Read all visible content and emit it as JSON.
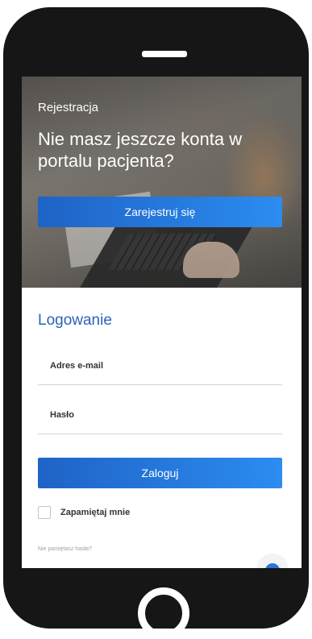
{
  "registration": {
    "label": "Rejestracja",
    "question": "Nie masz jeszcze konta w portalu pacjenta?",
    "button": "Zarejestruj się"
  },
  "login": {
    "title": "Logowanie",
    "email_label": "Adres e-mail",
    "password_label": "Hasło",
    "button": "Zaloguj",
    "remember_label": "Zapamiętaj mnie",
    "forgot_link": "Nie pamiętasz hasła?"
  },
  "colors": {
    "accent": "#2a62b8",
    "button_start": "#1f63c6",
    "button_end": "#2c8cf0",
    "phone_body": "#161616"
  },
  "icons": {
    "chat": "chat-bubble-icon",
    "home": "home-button-icon"
  }
}
